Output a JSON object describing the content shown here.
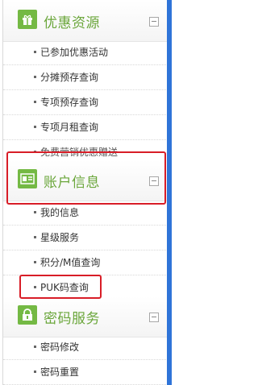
{
  "sections": [
    {
      "title": "优惠资源",
      "icon": "gift-icon"
    },
    {
      "title": "账户信息",
      "icon": "id-card-icon"
    },
    {
      "title": "密码服务",
      "icon": "lock-icon"
    }
  ],
  "items": [
    {
      "label": "已参加优惠活动"
    },
    {
      "label": "分摊预存查询"
    },
    {
      "label": "专项预存查询"
    },
    {
      "label": "专项月租查询"
    },
    {
      "label": "免费营销优惠赠送"
    },
    {
      "label": "我的信息"
    },
    {
      "label": "星级服务"
    },
    {
      "label": "积分/M值查询"
    },
    {
      "label": "PUK码查询"
    },
    {
      "label": "密码修改"
    },
    {
      "label": "密码重置"
    }
  ],
  "colors": {
    "accent_green": "#6aa63a",
    "icon_green": "#74b944",
    "highlight_red": "#d81d27",
    "rail_blue": "#2f74d8"
  }
}
